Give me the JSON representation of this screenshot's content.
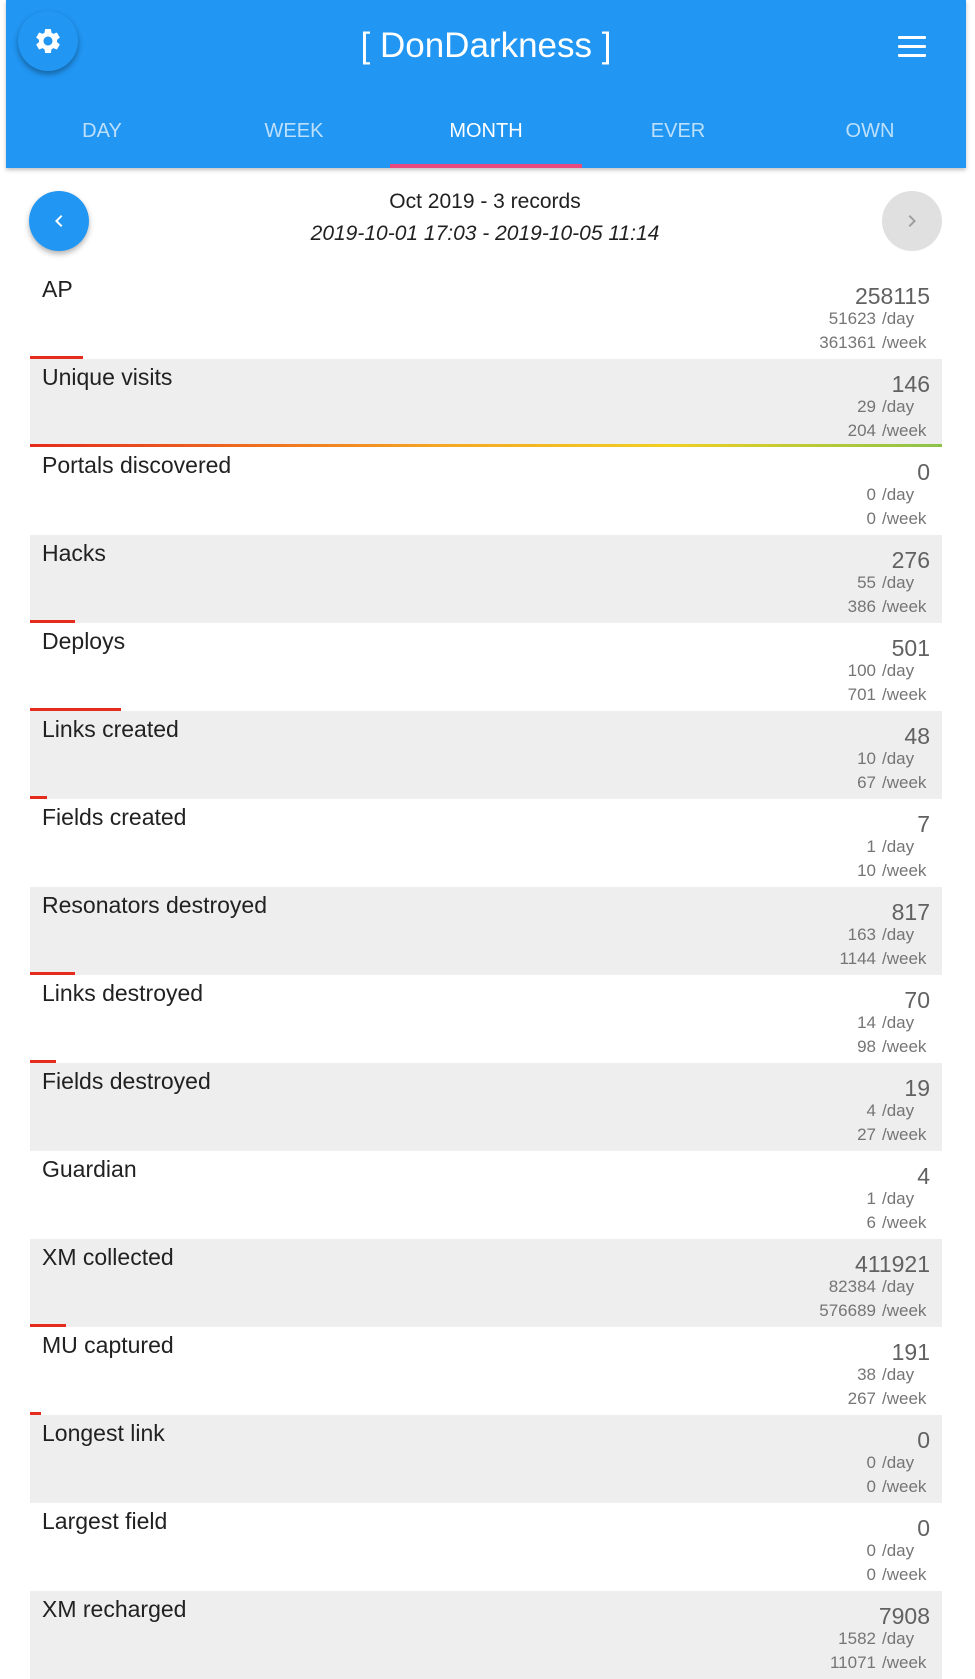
{
  "app": {
    "title": "[ DonDarkness ]",
    "colors": {
      "primary": "#2196f3",
      "tab_indicator": "#e8497f",
      "bar": "#e52b1c",
      "row_alt": "#eeeeee"
    },
    "icons": {
      "settings": "gear-icon",
      "menu": "hamburger-menu-icon",
      "prev": "chevron-left-icon",
      "next": "chevron-right-icon"
    }
  },
  "tabs": [
    {
      "label": "DAY",
      "active": false
    },
    {
      "label": "WEEK",
      "active": false
    },
    {
      "label": "MONTH",
      "active": true
    },
    {
      "label": "EVER",
      "active": false
    },
    {
      "label": "OWN",
      "active": false
    }
  ],
  "period": {
    "title": "Oct 2019 - 3 records",
    "range": "2019-10-01 17:03 - 2019-10-05 11:14"
  },
  "units": {
    "day": "/day",
    "week": "/week"
  },
  "stats": [
    {
      "label": "AP",
      "total": "258115",
      "per_day": "51623",
      "per_week": "361361",
      "progress": 0.058
    },
    {
      "label": "Unique visits",
      "total": "146",
      "per_day": "29",
      "per_week": "204",
      "progress": 1.0
    },
    {
      "label": "Portals discovered",
      "total": "0",
      "per_day": "0",
      "per_week": "0",
      "progress": 0
    },
    {
      "label": "Hacks",
      "total": "276",
      "per_day": "55",
      "per_week": "386",
      "progress": 0.049
    },
    {
      "label": "Deploys",
      "total": "501",
      "per_day": "100",
      "per_week": "701",
      "progress": 0.1
    },
    {
      "label": "Links created",
      "total": "48",
      "per_day": "10",
      "per_week": "67",
      "progress": 0.019
    },
    {
      "label": "Fields created",
      "total": "7",
      "per_day": "1",
      "per_week": "10",
      "progress": 0
    },
    {
      "label": "Resonators destroyed",
      "total": "817",
      "per_day": "163",
      "per_week": "1144",
      "progress": 0.049
    },
    {
      "label": "Links destroyed",
      "total": "70",
      "per_day": "14",
      "per_week": "98",
      "progress": 0.029
    },
    {
      "label": "Fields destroyed",
      "total": "19",
      "per_day": "4",
      "per_week": "27",
      "progress": 0
    },
    {
      "label": "Guardian",
      "total": "4",
      "per_day": "1",
      "per_week": "6",
      "progress": 0
    },
    {
      "label": "XM collected",
      "total": "411921",
      "per_day": "82384",
      "per_week": "576689",
      "progress": 0.039
    },
    {
      "label": "MU captured",
      "total": "191",
      "per_day": "38",
      "per_week": "267",
      "progress": 0.009
    },
    {
      "label": "Longest link",
      "total": "0",
      "per_day": "0",
      "per_week": "0",
      "progress": 0
    },
    {
      "label": "Largest field",
      "total": "0",
      "per_day": "0",
      "per_week": "0",
      "progress": 0
    },
    {
      "label": "XM recharged",
      "total": "7908",
      "per_day": "1582",
      "per_week": "11071",
      "progress": 0
    }
  ]
}
